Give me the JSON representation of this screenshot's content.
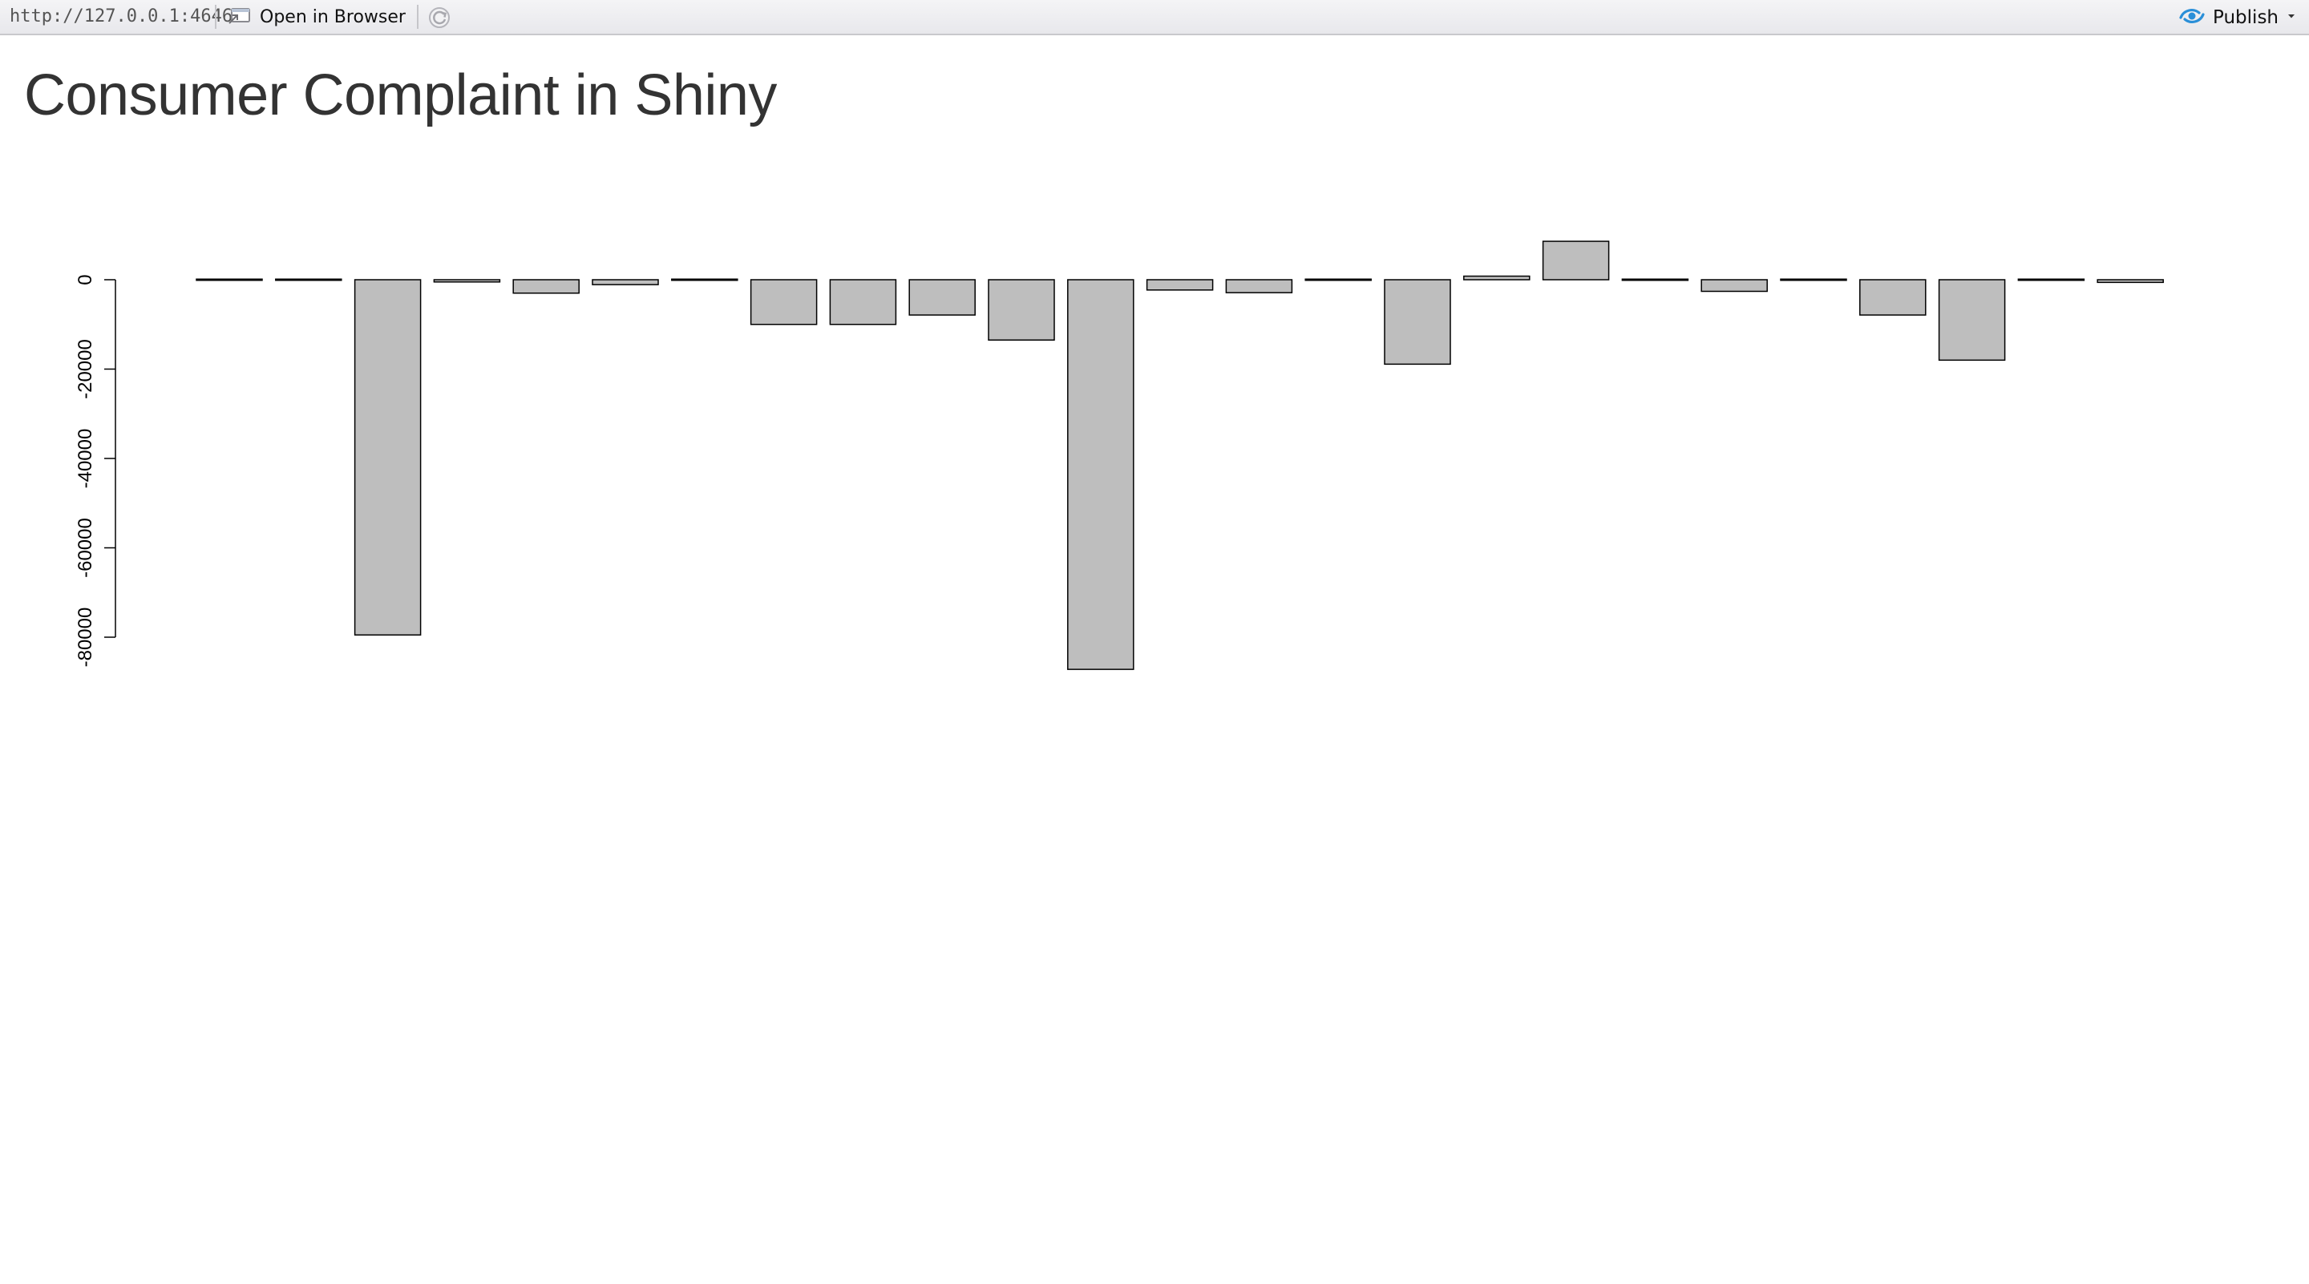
{
  "viewer_toolbar": {
    "url": "http://127.0.0.1:4646",
    "open_in_browser_label": "Open in Browser",
    "publish_label": "Publish"
  },
  "page": {
    "title": "Consumer Complaint in Shiny"
  },
  "chart_data": {
    "type": "bar",
    "bar_color": "#bebebe",
    "bar_border_color": "#000000",
    "ylim": [
      -90000,
      0
    ],
    "y_ticks": [
      0,
      -20000,
      -40000,
      -60000,
      -80000
    ],
    "y_tick_labels": [
      "0",
      "-20000",
      "-40000",
      "-60000",
      "-80000"
    ],
    "values": [
      -200,
      -100,
      -79500,
      -500,
      -3000,
      -1100,
      -100,
      -10000,
      -10000,
      -7900,
      -13500,
      -87200,
      -2300,
      -2900,
      -100,
      -18900,
      800,
      8600,
      -100,
      -2600,
      -100,
      -7900,
      -18000,
      -100,
      -600
    ],
    "grid": false,
    "legend": "none"
  }
}
